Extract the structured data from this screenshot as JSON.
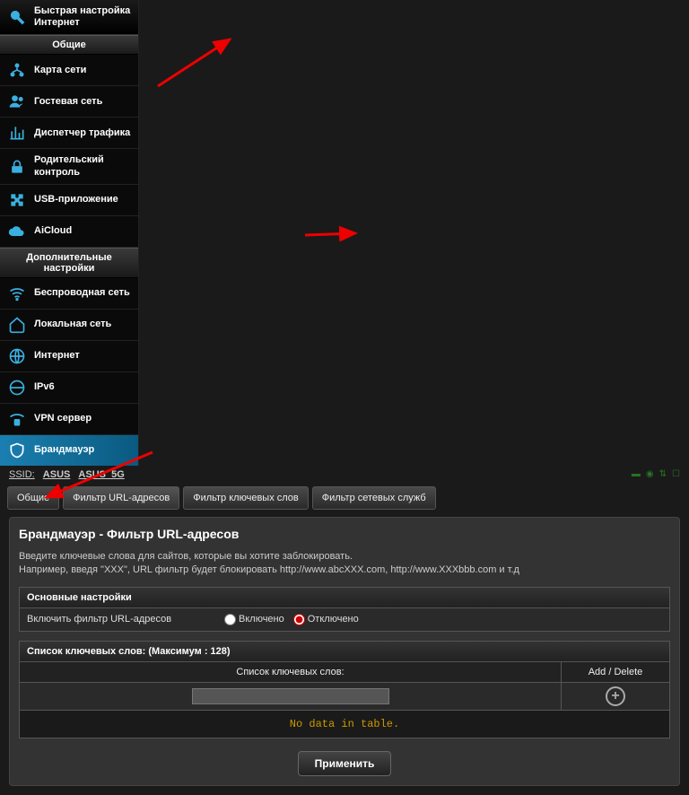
{
  "ssid": {
    "label": "SSID:",
    "names": [
      "ASUS",
      "ASUS_5G"
    ]
  },
  "sidebar": {
    "quick": "Быстрая настройка Интернет",
    "group1": "Общие",
    "items1": [
      {
        "label": "Карта сети"
      },
      {
        "label": "Гостевая сеть"
      },
      {
        "label": "Диспетчер трафика"
      },
      {
        "label": "Родительский контроль"
      },
      {
        "label": "USB-приложение"
      },
      {
        "label": "AiCloud"
      }
    ],
    "group2": "Дополнительные настройки",
    "items2": [
      {
        "label": "Беспроводная сеть"
      },
      {
        "label": "Локальная сеть"
      },
      {
        "label": "Интернет"
      },
      {
        "label": "IPv6"
      },
      {
        "label": "VPN сервер"
      },
      {
        "label": "Брандмауэр"
      }
    ]
  },
  "tabs": [
    {
      "label": "Общие"
    },
    {
      "label": "Фильтр URL-адресов"
    },
    {
      "label": "Фильтр ключевых слов"
    },
    {
      "label": "Фильтр сетевых служб"
    }
  ],
  "panel": {
    "title": "Брандмауэр - Фильтр URL-адресов",
    "desc1": "Введите ключевые слова для сайтов, которые вы хотите заблокировать.",
    "desc2": "Например, введя \"XXX\", URL фильтр будет блокировать http://www.abcXXX.com, http://www.XXXbbb.com и т.д",
    "section1": "Основные настройки",
    "enable_label": "Включить фильтр URL-адресов",
    "radio_on": "Включено",
    "radio_off": "Отключено",
    "section2": "Список ключевых слов: (Максимум : 128)",
    "col_kw": "Список ключевых слов:",
    "col_act": "Add / Delete",
    "nodata": "No data in table.",
    "apply": "Применить"
  }
}
